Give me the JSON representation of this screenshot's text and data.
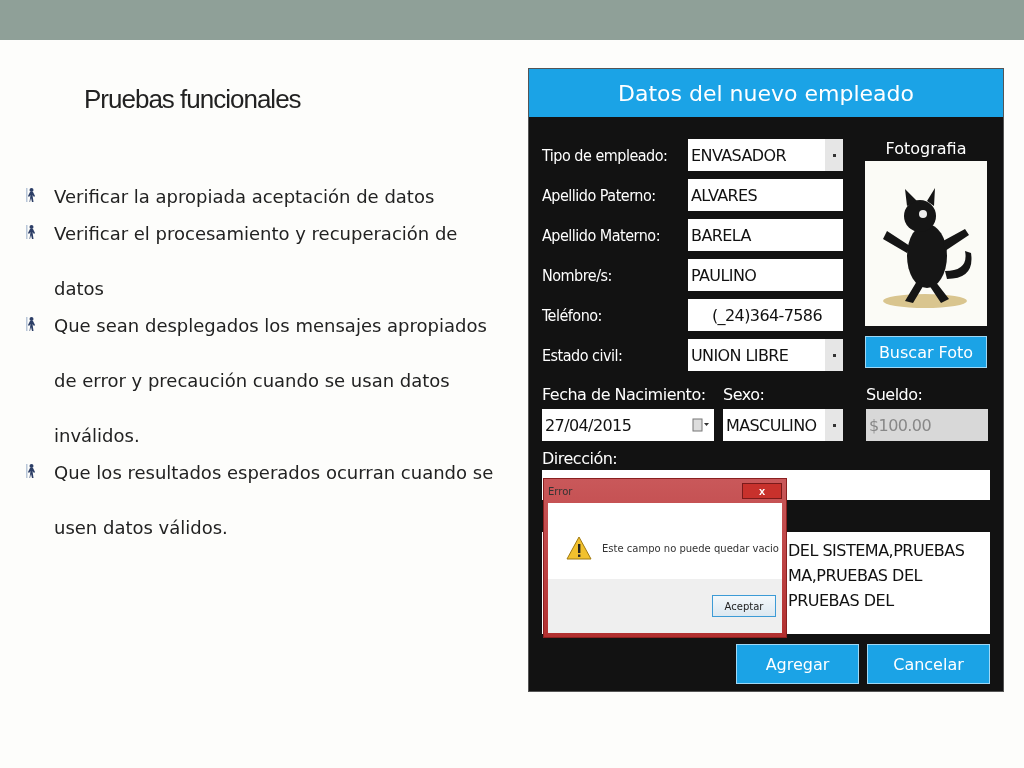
{
  "slide": {
    "title": "Pruebas funcionales",
    "bullets": [
      {
        "text": "Verificar la apropiada aceptación de datos"
      },
      {
        "text": "Verificar el procesamiento y recuperación de datos"
      },
      {
        "text": "Que sean desplegados los mensajes apropiados de error y precaución cuando se usan datos inválidos."
      },
      {
        "text": "Que los resultados esperados ocurran cuando se usen datos válidos."
      }
    ]
  },
  "app": {
    "title": "Datos del nuevo empleado",
    "fields": [
      {
        "label": "Tipo de empleado:",
        "value": "ENVASADOR",
        "kind": "dropdown"
      },
      {
        "label": "Apellido Paterno:",
        "value": "ALVARES",
        "kind": "text"
      },
      {
        "label": "Apellido Materno:",
        "value": "BARELA",
        "kind": "text"
      },
      {
        "label": "Nombre/s:",
        "value": "PAULINO",
        "kind": "text"
      },
      {
        "label": "Teléfono:",
        "value": "(_24)364-7586",
        "kind": "masked"
      },
      {
        "label": "Estado civil:",
        "value": "UNION LIBRE",
        "kind": "dropdown"
      }
    ],
    "photo": {
      "label": "Fotografia",
      "button": "Buscar Foto"
    },
    "birth_date": {
      "label": "Fecha de Nacimiento:",
      "value": "27/04/2015"
    },
    "sex": {
      "label": "Sexo:",
      "value": "MASCULINO"
    },
    "salary": {
      "label": "Sueldo:",
      "value": "$100.00",
      "disabled": true
    },
    "address": {
      "label": "Dirección:"
    },
    "notes": {
      "lines": [
        "DEL SISTEMA,PRUEBAS",
        "MA,PRUEBAS DEL",
        "PRUEBAS DEL"
      ]
    },
    "buttons": [
      "Agregar",
      "Cancelar"
    ]
  },
  "dialog": {
    "title": "Error",
    "close": "x",
    "message": "Este campo no puede quedar vacio",
    "button": "Aceptar"
  }
}
